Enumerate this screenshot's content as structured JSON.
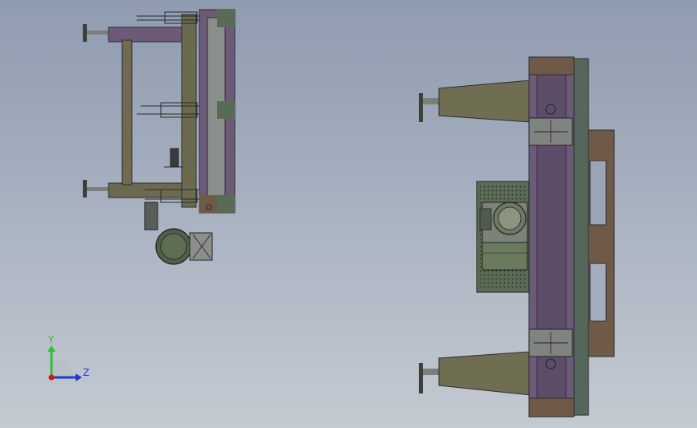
{
  "triad": {
    "y_label": "Y",
    "z_label": "Z",
    "y_color": "#2fbf2f",
    "z_color": "#1e3cc8",
    "origin_color": "#d01818"
  },
  "colors": {
    "background_top": "#8f9bb0",
    "background_bottom": "#c4cad2",
    "frame_olive": "#6b6a4e",
    "frame_purple": "#6c5a78",
    "frame_green": "#5a6b55",
    "frame_brown": "#6f5a48",
    "metal_grey": "#8a8f8c"
  }
}
